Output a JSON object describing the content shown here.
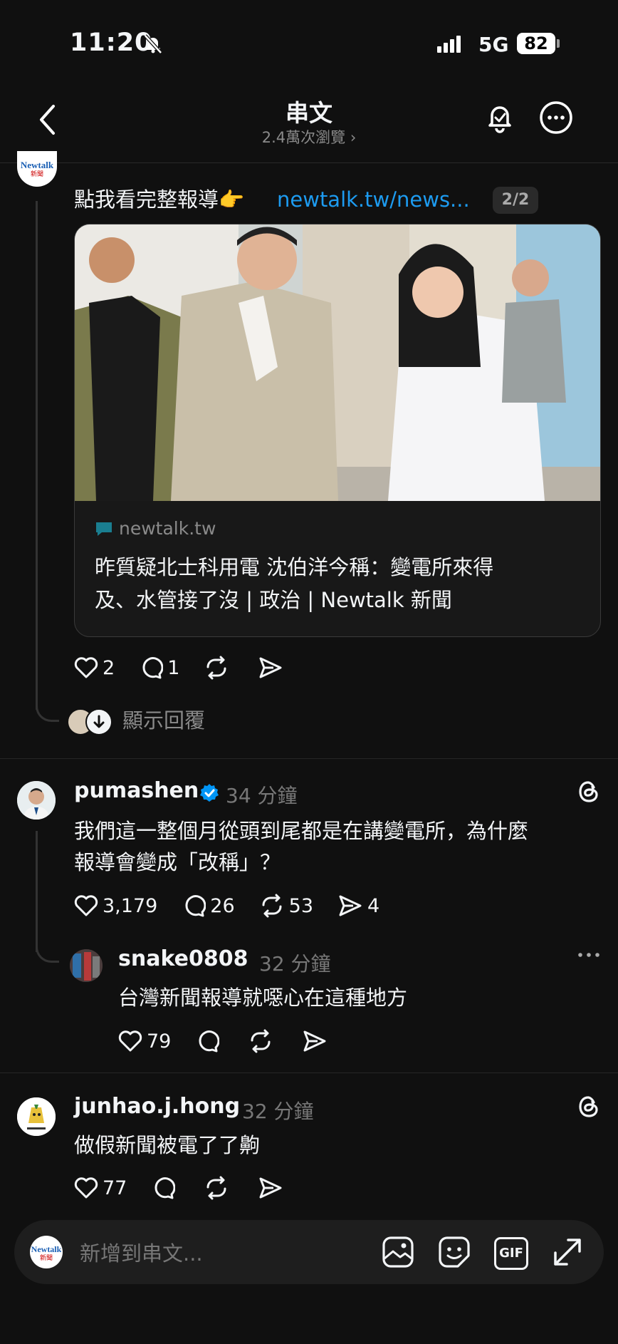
{
  "status_bar": {
    "time": "11:20",
    "network": "5G",
    "battery": "82"
  },
  "header": {
    "title": "串文",
    "subtitle": "2.4萬次瀏覽 ›"
  },
  "post1": {
    "text": "點我看完整報導👉",
    "link": "newtalk.tw/news...",
    "page_counter": "2/2",
    "card": {
      "domain": "newtalk.tw",
      "title_line1": "昨質疑北士科用電 沈伯洋今稱：變電所來得",
      "title_line2": "及、水管接了沒 | 政治 | Newtalk 新聞"
    },
    "likes": "2",
    "replies": "1",
    "show_replies": "顯示回覆"
  },
  "post2": {
    "username": "pumashen",
    "time": "34 分鐘",
    "text_line1": "我們這一整個月從頭到尾都是在講變電所，為什麼",
    "text_line2": "報導會變成「改稱」？",
    "likes": "3,179",
    "replies": "26",
    "reposts": "53",
    "shares": "4"
  },
  "reply1": {
    "username": "snake0808",
    "time": "32 分鐘",
    "text": "台灣新聞報導就噁心在這種地方",
    "likes": "79"
  },
  "post3": {
    "username": "junhao.j.hong",
    "time": "32 分鐘",
    "text": "做假新聞被電了了齁",
    "likes": "77"
  },
  "compose": {
    "placeholder": "新增到串文...",
    "gif_label": "GIF"
  },
  "avatars": {
    "newtalk_label": "Newtalk",
    "newtalk_sub": "新聞"
  },
  "colors": {
    "background": "#101010",
    "link": "#1d9bf0",
    "verified": "#0095f6",
    "muted": "#777777"
  }
}
